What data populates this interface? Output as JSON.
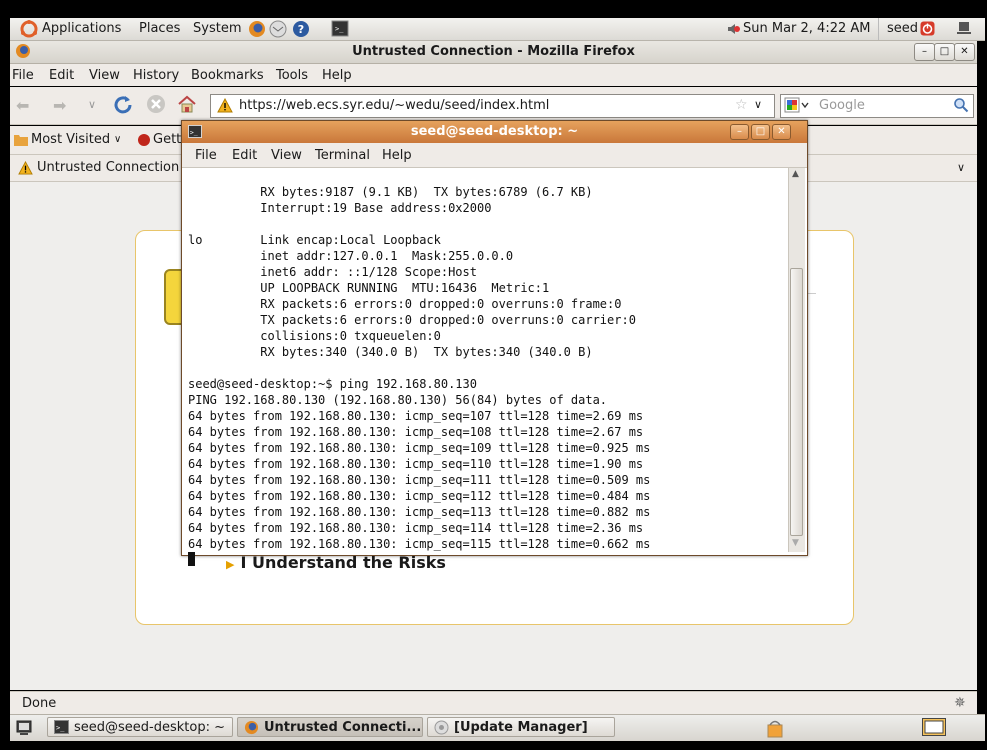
{
  "top_panel": {
    "applications": "Applications",
    "places": "Places",
    "system": "System",
    "clock": "Sun Mar  2,  4:22 AM",
    "user": "seed"
  },
  "firefox": {
    "title": "Untrusted Connection - Mozilla Firefox",
    "menu": [
      "File",
      "Edit",
      "View",
      "History",
      "Bookmarks",
      "Tools",
      "Help"
    ],
    "url": "https://web.ecs.syr.edu/~wedu/seed/index.html",
    "search_placeholder": "Google",
    "bookmarks": [
      "Most Visited",
      "Gett"
    ],
    "tab_title": "Untrusted Connection",
    "risks_link": "I Understand the Risks",
    "status": "Done"
  },
  "terminal": {
    "title": "seed@seed-desktop: ~",
    "menu": [
      "File",
      "Edit",
      "View",
      "Terminal",
      "Help"
    ],
    "lines": [
      "          RX bytes:9187 (9.1 KB)  TX bytes:6789 (6.7 KB)",
      "          Interrupt:19 Base address:0x2000",
      "",
      "lo        Link encap:Local Loopback",
      "          inet addr:127.0.0.1  Mask:255.0.0.0",
      "          inet6 addr: ::1/128 Scope:Host",
      "          UP LOOPBACK RUNNING  MTU:16436  Metric:1",
      "          RX packets:6 errors:0 dropped:0 overruns:0 frame:0",
      "          TX packets:6 errors:0 dropped:0 overruns:0 carrier:0",
      "          collisions:0 txqueuelen:0",
      "          RX bytes:340 (340.0 B)  TX bytes:340 (340.0 B)",
      "",
      "seed@seed-desktop:~$ ping 192.168.80.130",
      "PING 192.168.80.130 (192.168.80.130) 56(84) bytes of data.",
      "64 bytes from 192.168.80.130: icmp_seq=107 ttl=128 time=2.69 ms",
      "64 bytes from 192.168.80.130: icmp_seq=108 ttl=128 time=2.67 ms",
      "64 bytes from 192.168.80.130: icmp_seq=109 ttl=128 time=0.925 ms",
      "64 bytes from 192.168.80.130: icmp_seq=110 ttl=128 time=1.90 ms",
      "64 bytes from 192.168.80.130: icmp_seq=111 ttl=128 time=0.509 ms",
      "64 bytes from 192.168.80.130: icmp_seq=112 ttl=128 time=0.484 ms",
      "64 bytes from 192.168.80.130: icmp_seq=113 ttl=128 time=0.882 ms",
      "64 bytes from 192.168.80.130: icmp_seq=114 ttl=128 time=2.36 ms",
      "64 bytes from 192.168.80.130: icmp_seq=115 ttl=128 time=0.662 ms"
    ]
  },
  "taskbar": {
    "items": [
      "seed@seed-desktop: ~",
      "Untrusted Connecti...",
      "[Update Manager]"
    ]
  },
  "colors": {
    "terminal_title": "#d1874a",
    "warning": "#e5a000",
    "panel": "#efebe7"
  }
}
